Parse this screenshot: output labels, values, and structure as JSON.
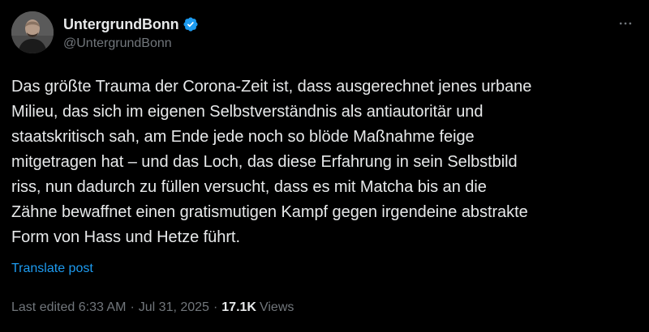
{
  "author": {
    "display_name": "UntergrundBonn",
    "handle": "@UntergrundBonn",
    "verified": true,
    "verified_color": "#1d9bf0"
  },
  "post": {
    "text": "Das größte Trauma der Corona-Zeit ist, dass ausgerechnet jenes urbane\nMilieu, das sich im eigenen Selbstverständnis als antiautoritär und\nstaatskritisch sah, am Ende jede noch so blöde Maßnahme feige\nmitgetragen hat – und das Loch, das diese Erfahrung in sein Selbstbild\nriss, nun dadurch zu füllen versucht, dass es mit Matcha bis an die\nZähne bewaffnet einen gratismutigen Kampf gegen irgendeine abstrakte\nForm von Hass und Hetze führt.",
    "translate_label": "Translate post"
  },
  "meta": {
    "edited_label": "Last edited 6:33 AM",
    "separator": "·",
    "date": "Jul 31, 2025",
    "views_count": "17.1K",
    "views_label": "Views"
  },
  "icons": {
    "more": "more-options-icon",
    "verified": "verified-badge-icon"
  },
  "colors": {
    "background": "#000000",
    "text_primary": "#e7e9ea",
    "text_secondary": "#71767b",
    "link": "#1d9bf0"
  }
}
